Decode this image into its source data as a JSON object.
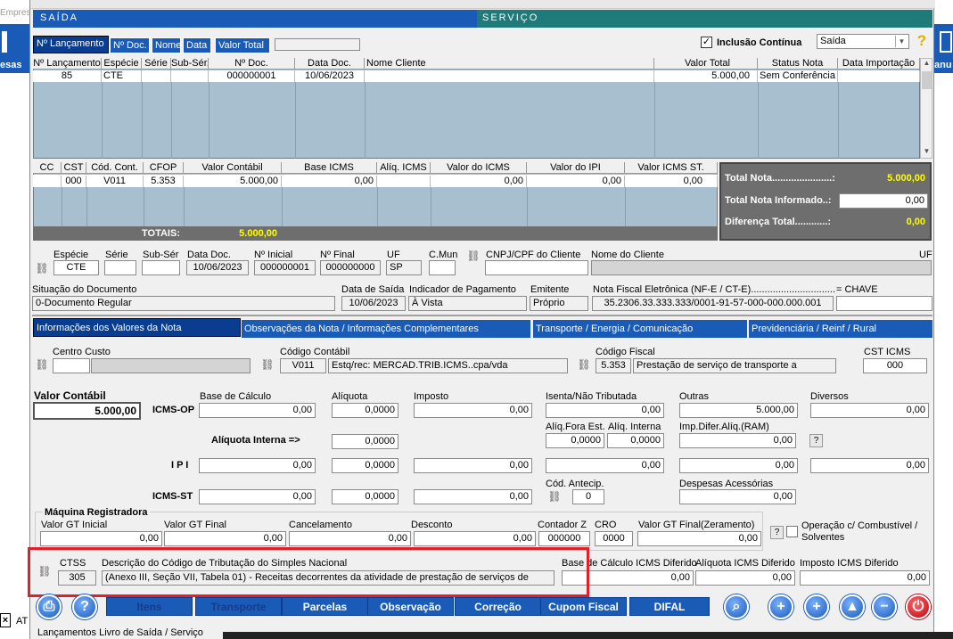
{
  "bg_left": {
    "top_text": "Empresa",
    "label": "esas",
    "bottom": "AT"
  },
  "bg_right": {
    "label": "anu"
  },
  "header": {
    "left": "SAÍDA",
    "right": "SERVIÇO"
  },
  "toolbar": {
    "tabs": [
      "Nº Lançamento",
      "Nº Doc.",
      "Nome",
      "Data",
      "Valor Total"
    ],
    "inclusao_label": "Inclusão Contínua",
    "tipo_select": "Saída"
  },
  "grid1": {
    "headers": [
      "Nº Lançamento",
      "Espécie",
      "Série",
      "Sub-Sér.",
      "Nº Doc.",
      "Data Doc.",
      "Nome Cliente",
      "Valor Total",
      "Status Nota",
      "Data Importação"
    ],
    "row": [
      "85",
      "CTE",
      "",
      "",
      "000000001",
      "10/06/2023",
      "",
      "5.000,00",
      "Sem Conferência",
      ""
    ]
  },
  "grid2": {
    "headers": [
      "CC",
      "CST",
      "Cód. Cont.",
      "CFOP",
      "Valor Contábil",
      "Base ICMS",
      "Alíq. ICMS",
      "Valor do ICMS",
      "Valor do IPI",
      "Valor ICMS ST."
    ],
    "row": [
      "",
      "000",
      "V011",
      "5.353",
      "5.000,00",
      "0,00",
      "",
      "0,00",
      "0,00",
      "0,00"
    ],
    "totais_label": "TOTAIS:",
    "totais_value": "5.000,00"
  },
  "summary": {
    "total_nota_label": "Total Nota......................:",
    "total_nota": "5.000,00",
    "informado_label": "Total Nota Informado..:",
    "informado": "0,00",
    "diferenca_label": "Diferença Total............:",
    "diferenca": "0,00"
  },
  "doc": {
    "especie_l": "Espécie",
    "especie": "CTE",
    "serie_l": "Série",
    "subser_l": "Sub-Sér",
    "data_l": "Data Doc.",
    "data": "10/06/2023",
    "ninicial_l": "Nº Inicial",
    "ninicial": "000000001",
    "nfinal_l": "Nº Final",
    "nfinal": "000000000",
    "uf_l": "UF",
    "uf": "SP",
    "cmun_l": "C.Mun",
    "cnpj_l": "CNPJ/CPF do Cliente",
    "nome_l": "Nome do Cliente",
    "uf2_l": "UF",
    "situacao_l": "Situação do Documento",
    "situacao": "0-Documento Regular",
    "datasaida_l": "Data de Saída",
    "datasaida": "10/06/2023",
    "indicador_l": "Indicador de Pagamento",
    "indicador": "À Vista",
    "emitente_l": "Emitente",
    "emitente": "Próprio",
    "nfe_l": "Nota Fiscal Eletrônica (NF-E / CT-E)...............................",
    "nfe": "35.2306.33.333.333/0001-91-57-000-000.000.001",
    "chave_l": "=  CHAVE"
  },
  "tabs": [
    "Informações dos Valores da Nota",
    "Observações da Nota / Informações Complementares",
    "Transporte / Energia / Comunicação",
    "Previdenciária / Reinf / Rural"
  ],
  "values": {
    "centro_l": "Centro Custo",
    "codcont_l": "Código Contábil",
    "codcont": "V011",
    "codcont_desc": "Estq/rec: MERCAD.TRIB.ICMS..cpa/vda",
    "codfis_l": "Código Fiscal",
    "codfis": "5.353",
    "codfis_desc": "Prestação de serviço de transporte a",
    "cst_l": "CST ICMS",
    "cst": "000",
    "valorcont_l": "Valor Contábil",
    "valorcont": "5.000,00",
    "icmsop_l": "ICMS-OP",
    "base_l": "Base de Cálculo",
    "aliq_l": "Alíquota",
    "imposto_l": "Imposto",
    "isenta_l": "Isenta/Não Tributada",
    "outras_l": "Outras",
    "diversos_l": "Diversos",
    "op": [
      "0,00",
      "0,0000",
      "0,00",
      "0,00",
      "5.000,00",
      "0,00"
    ],
    "aliqint_l": "Alíquota Interna =>",
    "aliqint": "0,0000",
    "aliqfora_l": "Alíq.Fora Est.",
    "aliqfora": "0,0000",
    "aliqint2_l": "Alíq. Interna",
    "aliqint2": "0,0000",
    "impdifer_l": "Imp.Difer.Alíq.(RAM)",
    "impdifer": "0,00",
    "help": "?",
    "ipi_l": "I P I",
    "ipi": [
      "0,00",
      "0,0000",
      "0,00",
      "0,00",
      "0,00",
      "0,00"
    ],
    "codantecip_l": "Cód. Antecip.",
    "codantecip": "0",
    "despesas_l": "Despesas Acessórias",
    "despesas": "0,00",
    "icmsst_l": "ICMS-ST",
    "st": [
      "0,00",
      "0,0000",
      "0,00"
    ]
  },
  "maquina": {
    "title": "Máquina Registradora",
    "gtinicial_l": "Valor GT Inicial",
    "gtinicial": "0,00",
    "gtfinal_l": "Valor GT Final",
    "gtfinal": "0,00",
    "cancel_l": "Cancelamento",
    "cancel": "0,00",
    "desconto_l": "Desconto",
    "desconto": "0,00",
    "contz_l": "Contador Z",
    "contz": "000000",
    "cro_l": "CRO",
    "cro": "0000",
    "gtzer_l": "Valor GT Final(Zeramento)",
    "gtzer": "0,00",
    "combustivel_l": "Operação c/ Combustível / Solventes"
  },
  "simples": {
    "ctss_l": "CTSS",
    "ctss": "305",
    "desc_l": "Descrição do Código de Tributação do Simples Nacional",
    "desc": "(Anexo III, Seção VII, Tabela 01) - Receitas decorrentes da atividade de prestação de serviços de",
    "basedif_l": "Base de Cálculo ICMS Diferido",
    "basedif": "0,00",
    "aliqdif_l": "Alíquota ICMS Diferido",
    "aliqdif": "0,00",
    "impdif_l": "Imposto ICMS Diferido",
    "impdif": "0,00"
  },
  "bottom": {
    "buttons": [
      "Itens",
      "Transporte",
      "Parcelas",
      "Observação",
      "Correção",
      "Cupom Fiscal",
      "DIFAL"
    ],
    "status": "Lançamentos Livro de Saída / Serviço"
  },
  "colors": {
    "blue": "#1a5bb8",
    "teal": "#1f7a7a",
    "dark": "#6e6e6e",
    "highlight": "#e0202a"
  }
}
